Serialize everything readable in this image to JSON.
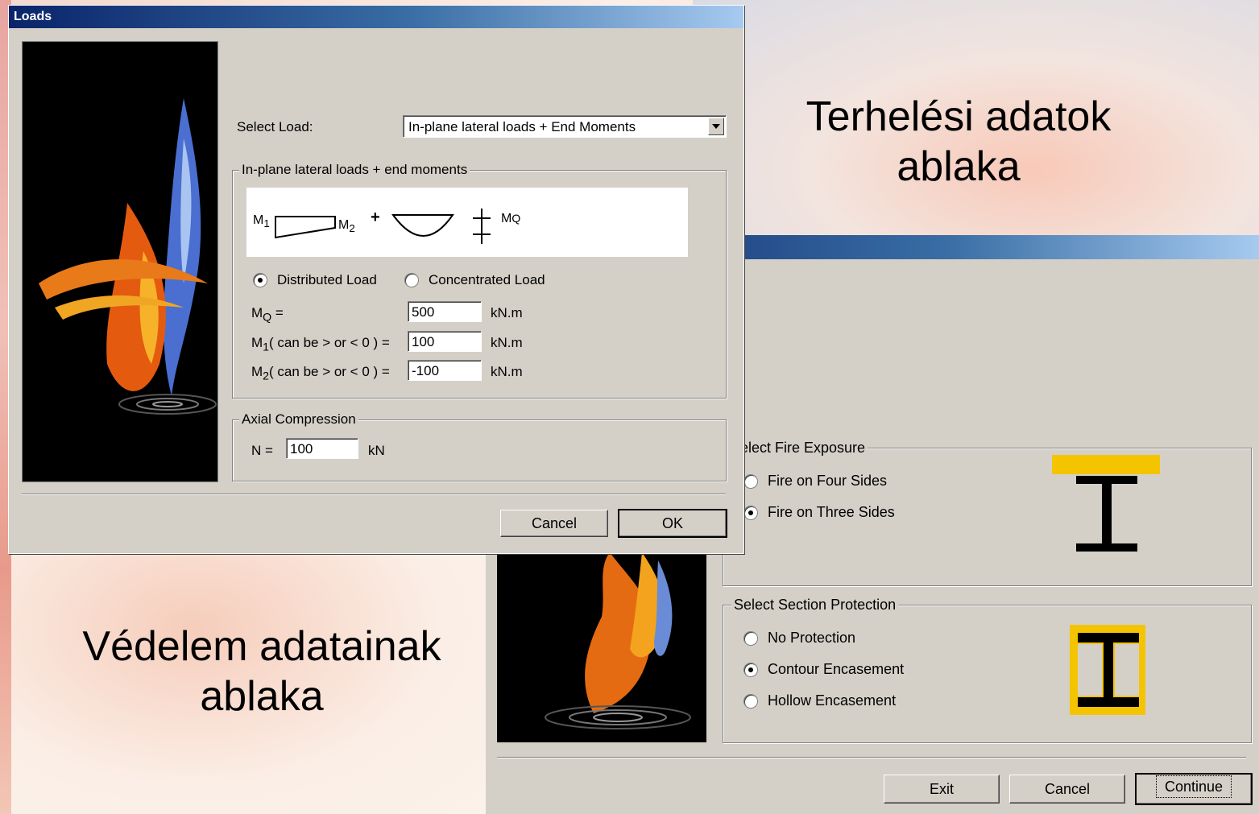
{
  "captions": {
    "loads_line1": "Terhelési adatok",
    "loads_line2": "ablaka",
    "protection_line1": "Védelem adatainak",
    "protection_line2": "ablaka"
  },
  "loads_window": {
    "title": "Loads",
    "select_load_label": "Select Load:",
    "select_load_value": "In-plane lateral loads + End Moments",
    "group_title": "In-plane lateral loads + end moments",
    "diagram": {
      "m1": "M",
      "m1_sub": "1",
      "m2": "M",
      "m2_sub": "2",
      "plus": "+",
      "mq": "M",
      "mq_sub": "Q"
    },
    "load_type_options": [
      {
        "label": "Distributed Load",
        "selected": true
      },
      {
        "label": "Concentrated Load",
        "selected": false
      }
    ],
    "fields": [
      {
        "label": "M",
        "sub": "Q",
        "suffix": " =",
        "value": "500",
        "unit": "kN.m"
      },
      {
        "label": "M",
        "sub": "1",
        "suffix": "( can be > or < 0 )  =",
        "value": "100",
        "unit": "kN.m"
      },
      {
        "label": "M",
        "sub": "2",
        "suffix": "( can be > or < 0 )  =",
        "value": "-100",
        "unit": "kN.m"
      }
    ],
    "axial_title": "Axial Compression",
    "axial_label": "N =",
    "axial_value": "100",
    "axial_unit": "kN",
    "cancel_label": "Cancel",
    "ok_label": "OK"
  },
  "protection_window": {
    "fire_exposure_title": "elect Fire Exposure",
    "fire_options": [
      {
        "label": "Fire on Four Sides",
        "selected": false
      },
      {
        "label": "Fire on Three Sides",
        "selected": true
      }
    ],
    "protection_title": "Select Section Protection",
    "protection_options": [
      {
        "label": "No Protection",
        "selected": false
      },
      {
        "label": "Contour Encasement",
        "selected": true
      },
      {
        "label": "Hollow Encasement",
        "selected": false
      }
    ],
    "exit_label": "Exit",
    "cancel_label": "Cancel",
    "continue_label": "Continue"
  },
  "colors": {
    "window_bg": "#d4d0c8",
    "title_start": "#0a246a",
    "title_end": "#a6caf0",
    "protection_yellow": "#f5c400"
  }
}
